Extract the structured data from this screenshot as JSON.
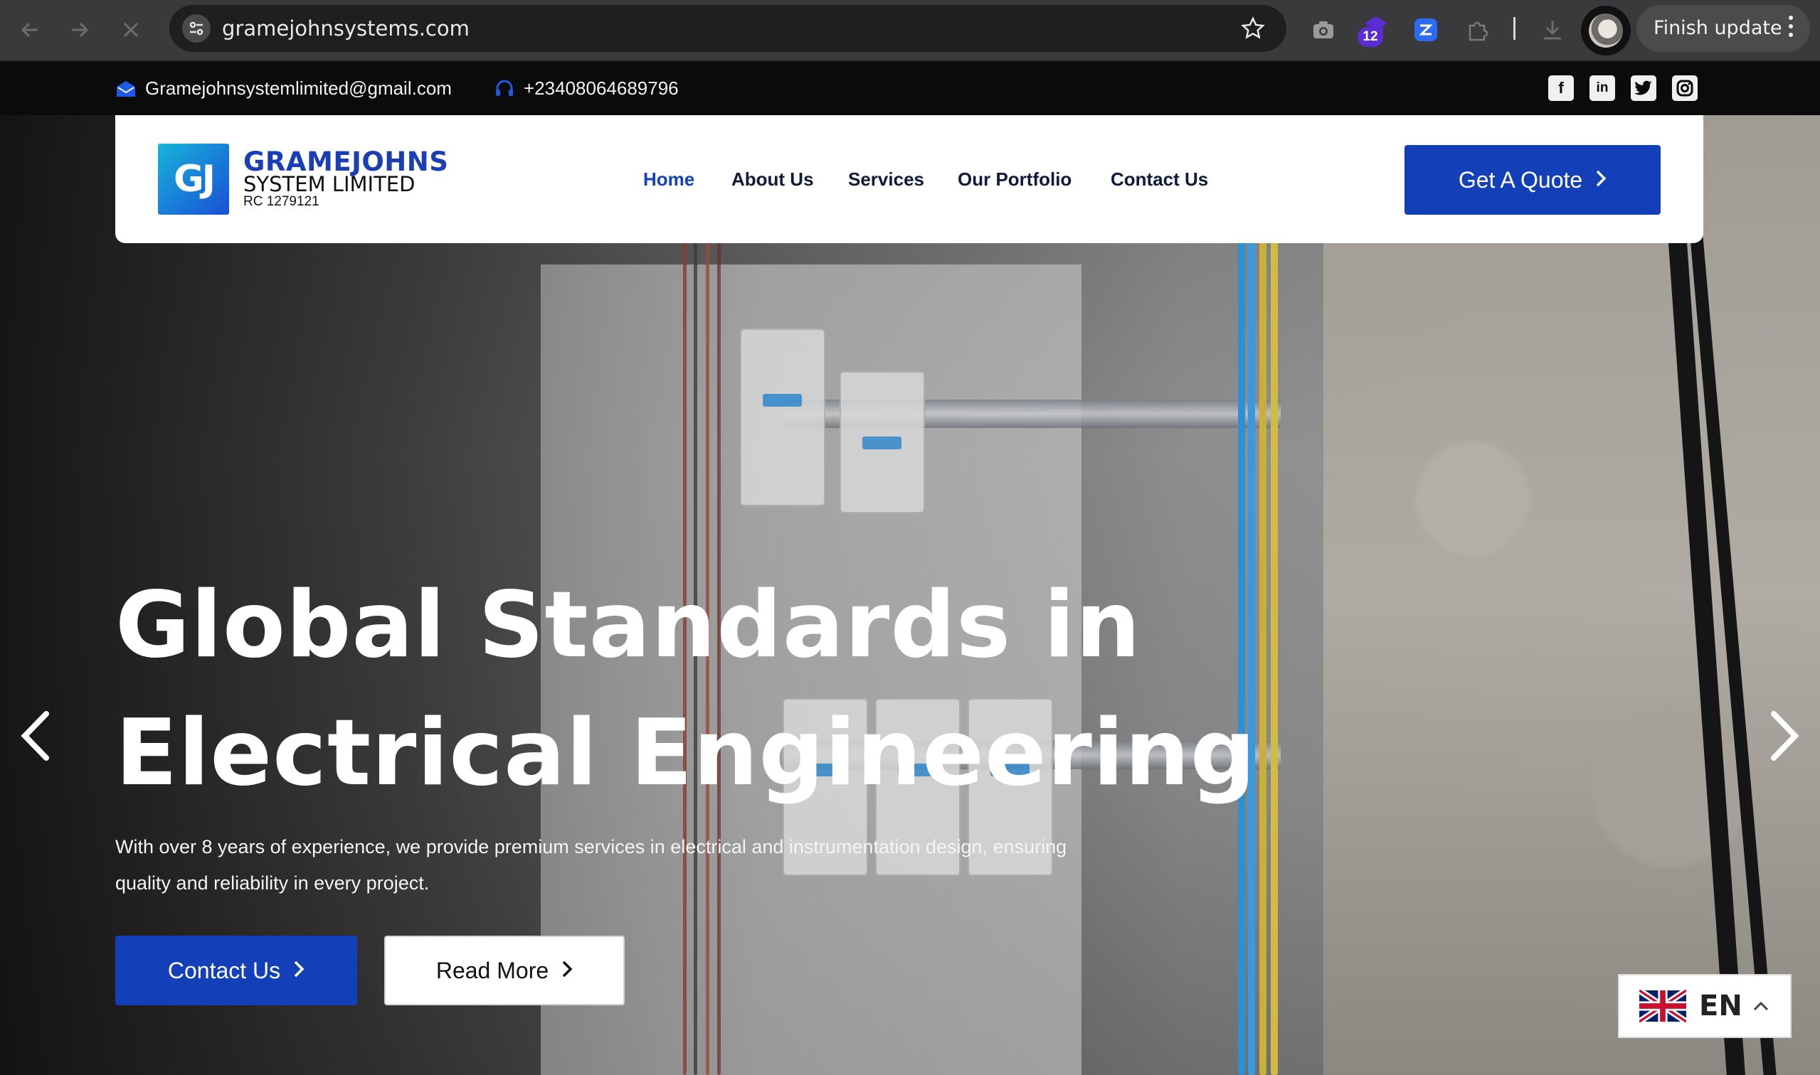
{
  "browser": {
    "url": "gramejohnsystems.com",
    "extension_badge": "12",
    "finish_update_label": "Finish update",
    "icons": [
      "back-arrow-icon",
      "forward-arrow-icon",
      "close-icon",
      "site-info-icon",
      "star-icon",
      "camera-icon",
      "extension-icon",
      "zoom-extension-icon",
      "puzzle-icon",
      "download-icon",
      "kebab-menu-icon"
    ]
  },
  "topbar": {
    "email": "Gramejohnsystemlimited@gmail.com",
    "phone": "+23408064689796",
    "social": [
      "facebook-icon",
      "linkedin-icon",
      "twitter-icon",
      "instagram-icon"
    ]
  },
  "header": {
    "logo_mark": "GJ",
    "logo_name": "GRAMEJOHNS",
    "logo_sub": "SYSTEM LIMITED",
    "logo_rc": "RC 1279121",
    "menu": [
      {
        "label": "Home",
        "active": true
      },
      {
        "label": "About Us",
        "active": false
      },
      {
        "label": "Services",
        "active": false
      },
      {
        "label": "Our Portfolio",
        "active": false
      },
      {
        "label": "Contact Us",
        "active": false
      }
    ],
    "cta_label": "Get A Quote"
  },
  "hero": {
    "title_line1": "Global Standards in",
    "title_line2": "Electrical Engineering",
    "description": "With over 8 years of experience, we provide premium services in electrical and instrumentation design, ensuring quality and reliability in every project.",
    "primary_button": "Contact Us",
    "secondary_button": "Read More"
  },
  "language": {
    "code": "EN",
    "flag": "uk-flag-icon"
  },
  "colors": {
    "brand_blue": "#1340b8",
    "link_blue": "#1642b8",
    "topbar_bg": "#0b0b0b"
  }
}
